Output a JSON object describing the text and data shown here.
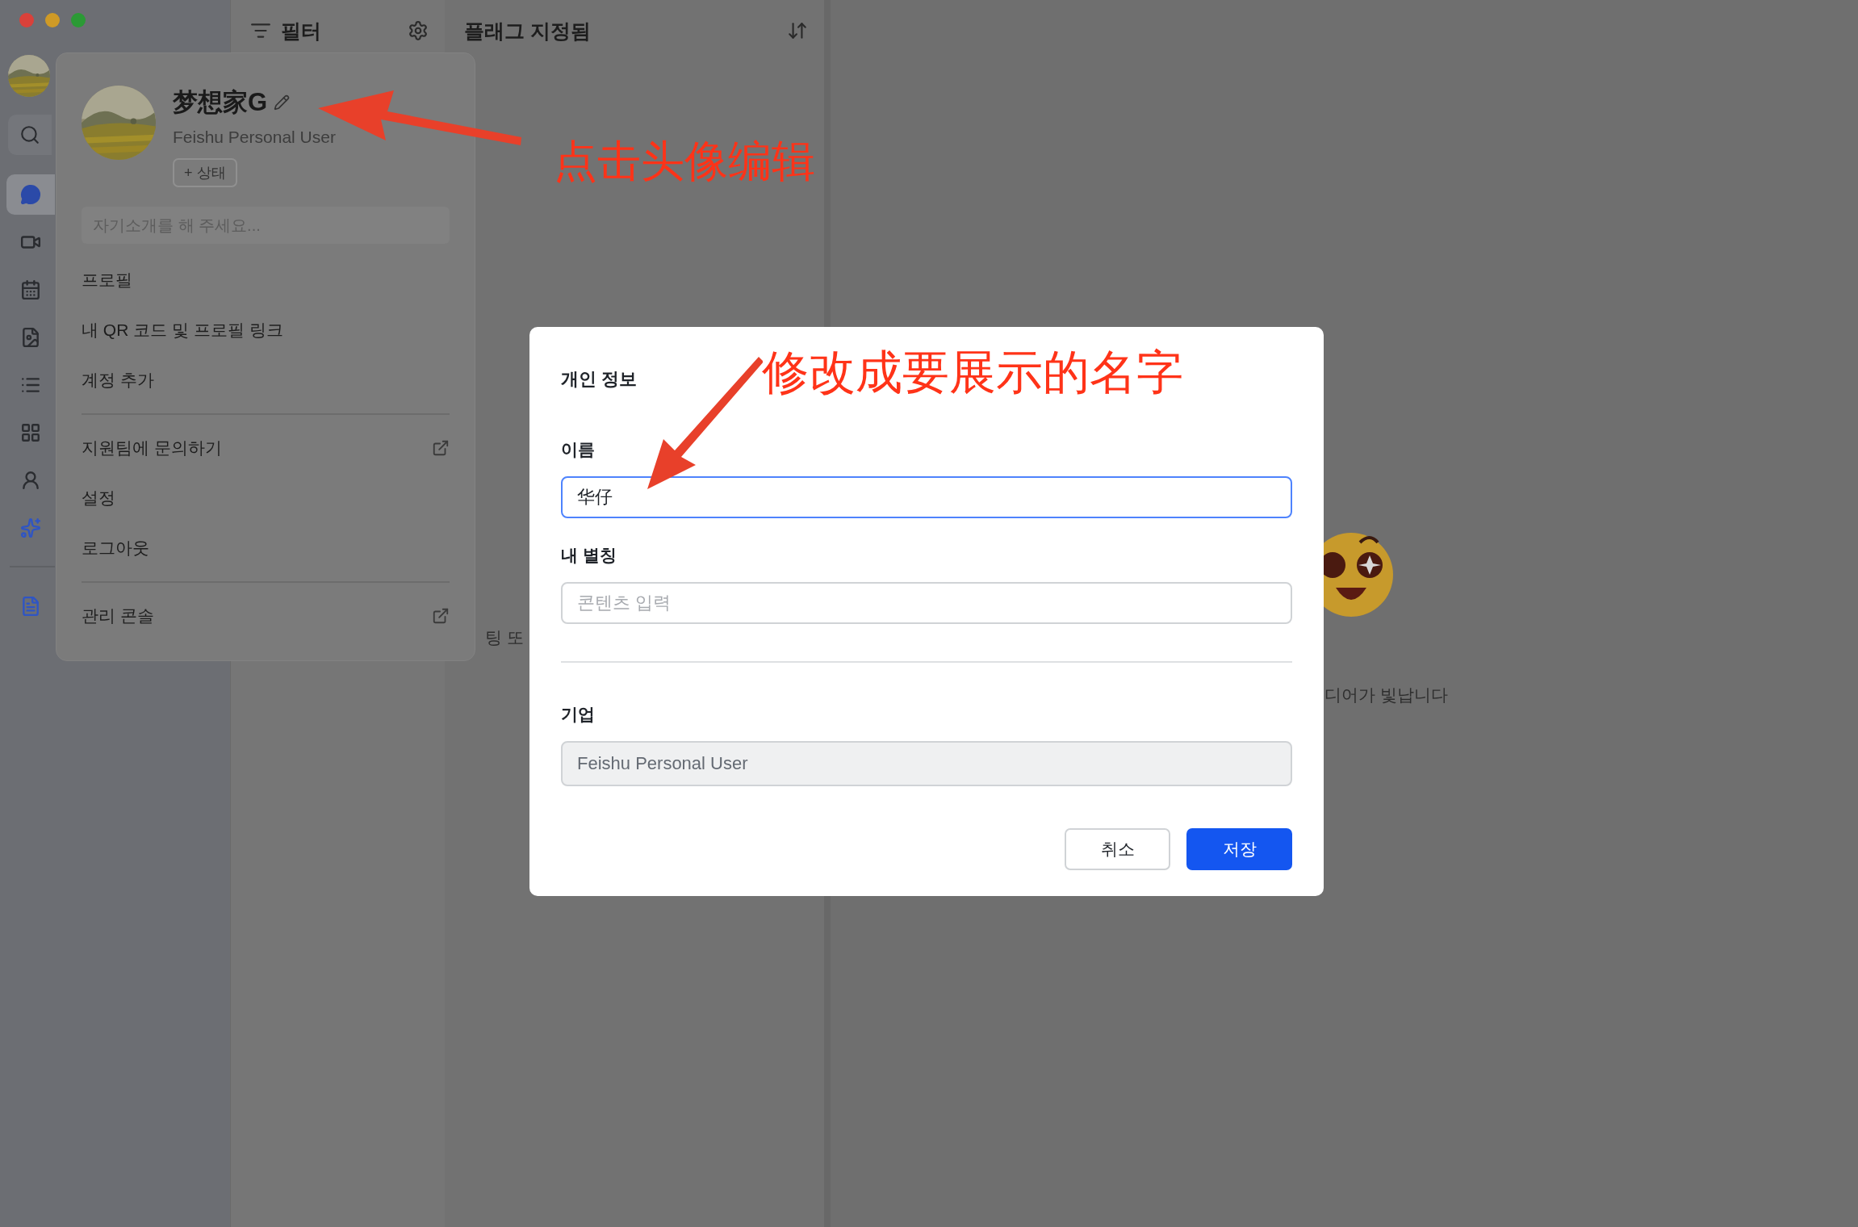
{
  "sidebar": {
    "items": [
      {
        "kind": "chat",
        "selected": true
      },
      {
        "kind": "video",
        "selected": false
      },
      {
        "kind": "calendar",
        "selected": false
      },
      {
        "kind": "docs",
        "selected": false
      },
      {
        "kind": "base",
        "selected": false
      },
      {
        "kind": "apps",
        "selected": false
      },
      {
        "kind": "contacts",
        "selected": false
      },
      {
        "kind": "workplace",
        "selected": false
      }
    ],
    "lower_items": [
      {
        "kind": "note",
        "selected": false
      }
    ]
  },
  "filter_panel": {
    "title": "필터"
  },
  "list_panel": {
    "title": "플래그 지정됨",
    "empty_text": "팅 또"
  },
  "main_panel": {
    "caption": "디어가 빛납니다"
  },
  "profile_menu": {
    "name": "梦想家G",
    "organization": "Feishu Personal User",
    "status_button": "+ 상태",
    "bio_placeholder": "자기소개를 해 주세요...",
    "sections": [
      {
        "items": [
          {
            "label": "프로필",
            "external": false
          },
          {
            "label": "내 QR 코드 및 프로필 링크",
            "external": false
          },
          {
            "label": "계정 추가",
            "external": false
          }
        ]
      },
      {
        "items": [
          {
            "label": "지원팀에 문의하기",
            "external": true
          },
          {
            "label": "설정",
            "external": false
          },
          {
            "label": "로그아웃",
            "external": false
          }
        ]
      },
      {
        "items": [
          {
            "label": "관리 콘솔",
            "external": true
          }
        ]
      }
    ]
  },
  "dialog": {
    "title": "개인 정보",
    "sections": [
      {
        "fields": [
          {
            "label": "이름",
            "value": "华仔",
            "focused": true,
            "disabled": false
          },
          {
            "label": "내 별칭",
            "placeholder": "콘텐츠 입력",
            "focused": false,
            "disabled": false
          }
        ]
      },
      {
        "fields": [
          {
            "label": "기업",
            "value": "Feishu Personal User",
            "focused": false,
            "disabled": true
          }
        ]
      }
    ],
    "buttons": [
      {
        "label": "취소",
        "kind": "secondary"
      },
      {
        "label": "저장",
        "kind": "primary"
      }
    ]
  },
  "annotations": [
    {
      "text": "点击头像编辑"
    },
    {
      "text": "修改成要展示的名字"
    }
  ]
}
